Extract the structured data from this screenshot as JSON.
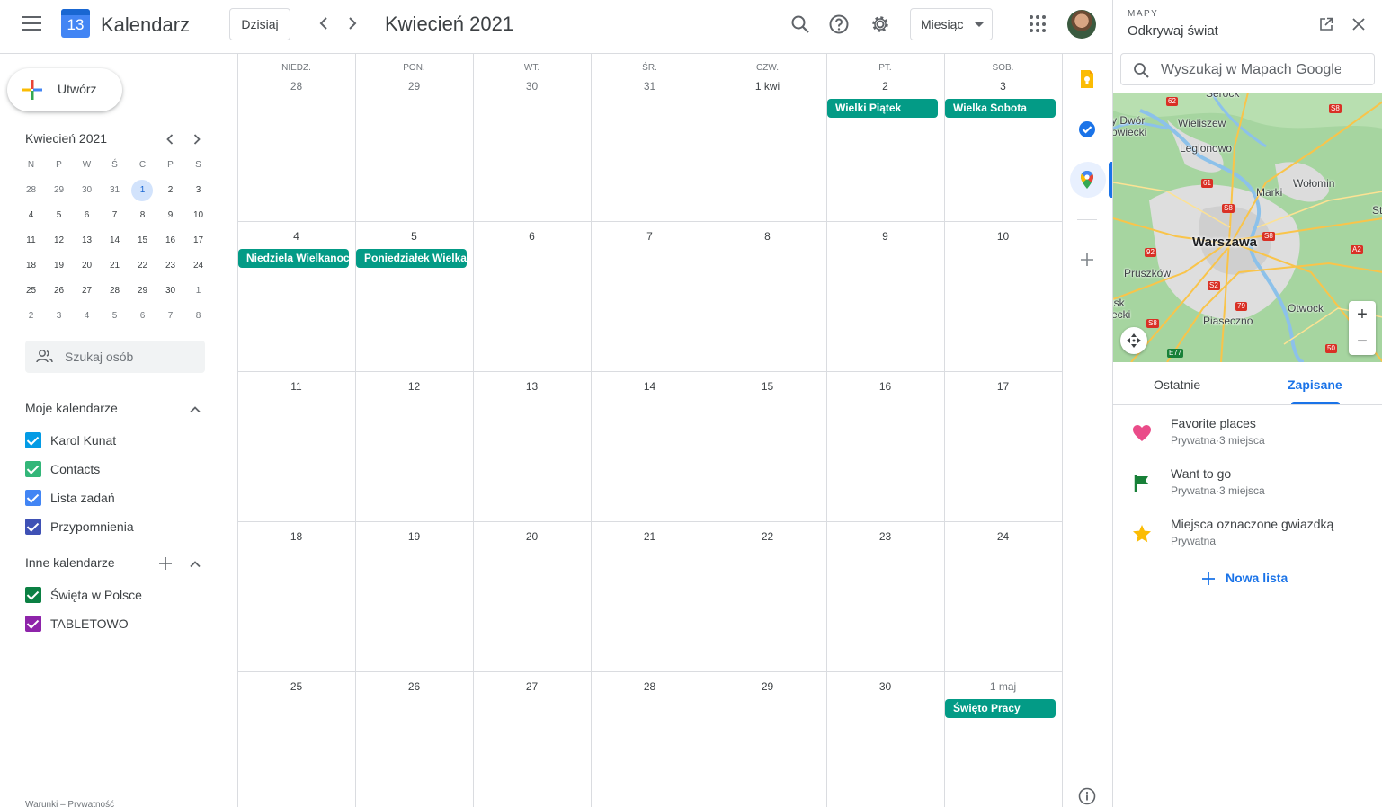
{
  "header": {
    "app_title": "Kalendarz",
    "logo_day": "13",
    "today_label": "Dzisiaj",
    "month_title": "Kwiecień 2021",
    "view_label": "Miesiąc",
    "prev_icon": "chevron-left-icon",
    "next_icon": "chevron-right-icon"
  },
  "sidebar": {
    "create_label": "Utwórz",
    "mini_title": "Kwiecień 2021",
    "mini_day_headers": [
      "N",
      "P",
      "W",
      "Ś",
      "C",
      "P",
      "S"
    ],
    "mini_weeks": [
      [
        "28",
        "29",
        "30",
        "31",
        "1",
        "2",
        "3"
      ],
      [
        "4",
        "5",
        "6",
        "7",
        "8",
        "9",
        "10"
      ],
      [
        "11",
        "12",
        "13",
        "14",
        "15",
        "16",
        "17"
      ],
      [
        "18",
        "19",
        "20",
        "21",
        "22",
        "23",
        "24"
      ],
      [
        "25",
        "26",
        "27",
        "28",
        "29",
        "30",
        "1"
      ],
      [
        "2",
        "3",
        "4",
        "5",
        "6",
        "7",
        "8"
      ]
    ],
    "people_placeholder": "Szukaj osób",
    "my_calendars_title": "Moje kalendarze",
    "my_calendars": [
      {
        "name": "Karol Kunat",
        "color": "#039be5"
      },
      {
        "name": "Contacts",
        "color": "#33b679"
      },
      {
        "name": "Lista zadań",
        "color": "#4285f4"
      },
      {
        "name": "Przypomnienia",
        "color": "#3f51b5"
      }
    ],
    "other_calendars_title": "Inne kalendarze",
    "other_calendars": [
      {
        "name": "Święta w Polsce",
        "color": "#0b8043"
      },
      {
        "name": "TABLETOWO",
        "color": "#8e24aa"
      }
    ],
    "footer": "Warunki – Prywatność"
  },
  "calendar": {
    "day_headers": [
      "NIEDZ.",
      "PON.",
      "WT.",
      "ŚR.",
      "CZW.",
      "PT.",
      "SOB."
    ],
    "weeks": [
      [
        "28",
        "29",
        "30",
        "31",
        "1 kwi",
        "2",
        "3"
      ],
      [
        "4",
        "5",
        "6",
        "7",
        "8",
        "9",
        "10"
      ],
      [
        "11",
        "12",
        "13",
        "14",
        "15",
        "16",
        "17"
      ],
      [
        "18",
        "19",
        "20",
        "21",
        "22",
        "23",
        "24"
      ],
      [
        "25",
        "26",
        "27",
        "28",
        "29",
        "30",
        "1 maj"
      ]
    ],
    "events": [
      {
        "title": "Wielki Piątek",
        "week": 0,
        "day": 5
      },
      {
        "title": "Wielka Sobota",
        "week": 0,
        "day": 6
      },
      {
        "title": "Niedziela Wielkanocna",
        "week": 1,
        "day": 0
      },
      {
        "title": "Poniedziałek Wielkanocny",
        "week": 1,
        "day": 1
      },
      {
        "title": "Święto Pracy",
        "week": 4,
        "day": 6
      }
    ],
    "event_color": "#039b86"
  },
  "side_panel_icons": [
    "keep-icon",
    "tasks-icon",
    "maps-icon",
    "add-addon-icon",
    "info-icon"
  ],
  "maps": {
    "label": "MAPY",
    "title": "Odkrywaj świat",
    "search_placeholder": "Wyszukaj w Mapach Google",
    "map_labels": {
      "city": "Warszawa",
      "towns": [
        "Legionowo",
        "Wieliszew",
        "Marki",
        "Wołomin",
        "Pruszków",
        "Piaseczno",
        "Otwock",
        "Serock",
        "y Dwór",
        "owiecki",
        "isk",
        "ecki",
        "St"
      ]
    },
    "road_shields": [
      "62",
      "S8",
      "61",
      "S8",
      "S8",
      "92",
      "A2",
      "S2",
      "79",
      "S8",
      "E77",
      "50"
    ],
    "tabs": [
      "Ostatnie",
      "Zapisane"
    ],
    "active_tab": "Zapisane",
    "lists": [
      {
        "title": "Favorite places",
        "subtitle": "Prywatna·3 miejsca",
        "icon": "heart-icon",
        "color": "#ea4c89"
      },
      {
        "title": "Want to go",
        "subtitle": "Prywatna·3 miejsca",
        "icon": "flag-icon",
        "color": "#188038"
      },
      {
        "title": "Miejsca oznaczone gwiazdką",
        "subtitle": "Prywatna",
        "icon": "star-icon",
        "color": "#fbbc04"
      }
    ],
    "new_list_label": "Nowa lista"
  }
}
